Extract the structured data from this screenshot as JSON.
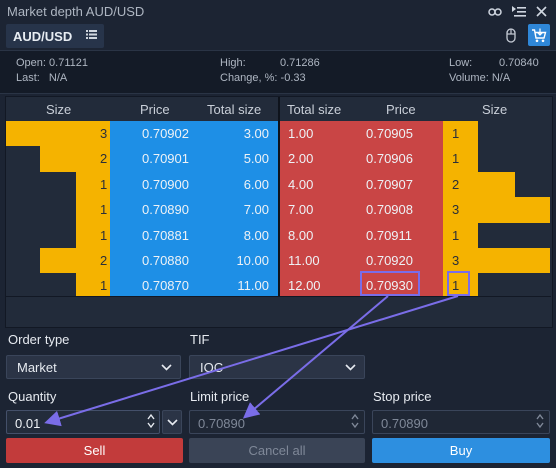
{
  "window": {
    "title": "Market depth AUD/USD"
  },
  "symbol": {
    "name": "AUD/USD"
  },
  "stats": {
    "open_label": "Open:",
    "open_value": "0.71121",
    "last_label": "Last:",
    "last_value": "N/A",
    "high_label": "High:",
    "high_value": "0.71286",
    "change_label": "Change, %:",
    "change_value": "-0.33",
    "low_label": "Low:",
    "low_value": "0.70840",
    "volume_label": "Volume:",
    "volume_value": "N/A"
  },
  "book": {
    "headers": {
      "bid_size": "Size",
      "bid_price": "Price",
      "bid_total": "Total size",
      "ask_total": "Total size",
      "ask_price": "Price",
      "ask_size": "Size"
    },
    "bids": [
      {
        "size": "3",
        "price": "0.70902",
        "total": "3.00",
        "bar": 1.0
      },
      {
        "size": "2",
        "price": "0.70901",
        "total": "5.00",
        "bar": 0.67
      },
      {
        "size": "1",
        "price": "0.70900",
        "total": "6.00",
        "bar": 0.33
      },
      {
        "size": "1",
        "price": "0.70890",
        "total": "7.00",
        "bar": 0.33
      },
      {
        "size": "1",
        "price": "0.70881",
        "total": "8.00",
        "bar": 0.33
      },
      {
        "size": "2",
        "price": "0.70880",
        "total": "10.00",
        "bar": 0.67
      },
      {
        "size": "1",
        "price": "0.70870",
        "total": "11.00",
        "bar": 0.33
      }
    ],
    "asks": [
      {
        "total": "1.00",
        "price": "0.70905",
        "size": "1",
        "bar": 0.33
      },
      {
        "total": "2.00",
        "price": "0.70906",
        "size": "1",
        "bar": 0.33
      },
      {
        "total": "4.00",
        "price": "0.70907",
        "size": "2",
        "bar": 0.67
      },
      {
        "total": "7.00",
        "price": "0.70908",
        "size": "3",
        "bar": 1.0
      },
      {
        "total": "8.00",
        "price": "0.70911",
        "size": "1",
        "bar": 0.33
      },
      {
        "total": "11.00",
        "price": "0.70920",
        "size": "3",
        "bar": 1.0
      },
      {
        "total": "12.00",
        "price": "0.70930",
        "size": "1",
        "bar": 0.33
      }
    ]
  },
  "order": {
    "order_type_label": "Order type",
    "order_type_value": "Market",
    "tif_label": "TIF",
    "tif_value": "IOC",
    "quantity_label": "Quantity",
    "quantity_value": "0.01",
    "limit_label": "Limit price",
    "limit_value": "0.70890",
    "stop_label": "Stop price",
    "stop_value": "0.70890"
  },
  "buttons": {
    "sell": "Sell",
    "cancel_all": "Cancel all",
    "buy": "Buy"
  },
  "colors": {
    "bid_bg": "#1e8fe6",
    "ask_bg": "#c94545",
    "size_bar": "#f5b300",
    "sell": "#c23b3b",
    "buy": "#2d8fe0",
    "highlight": "#7a6de8"
  }
}
